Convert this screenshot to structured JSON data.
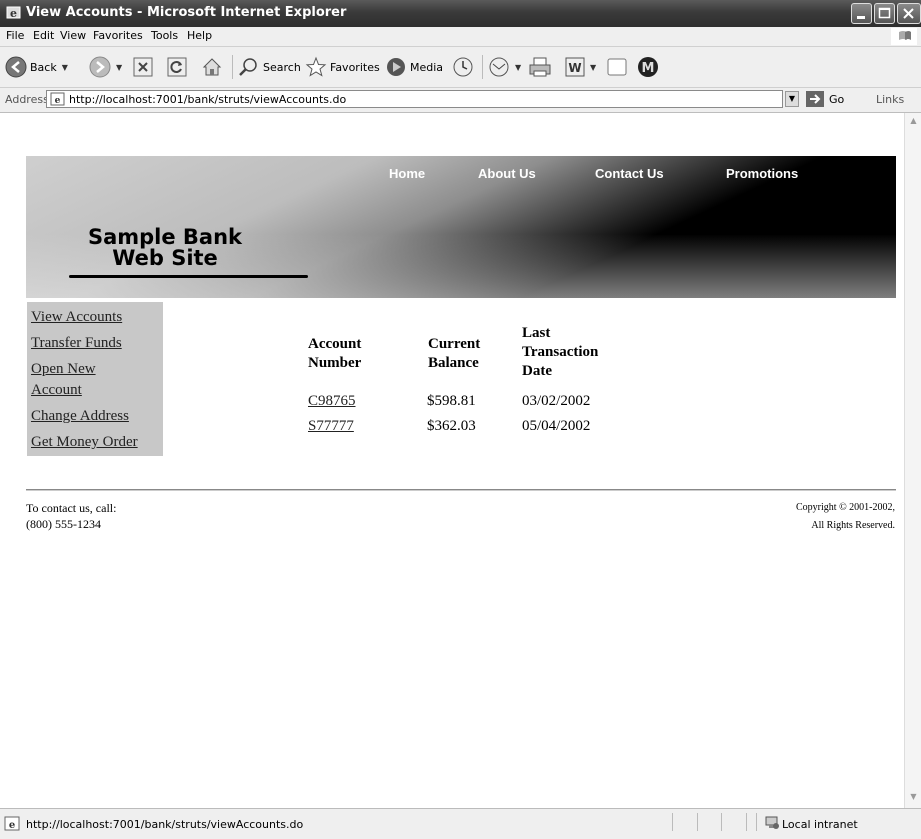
{
  "window": {
    "title": "View Accounts - Microsoft Internet Explorer"
  },
  "menu": [
    "File",
    "Edit",
    "View",
    "Favorites",
    "Tools",
    "Help"
  ],
  "toolbar": {
    "back_label": "Back",
    "search_label": "Search",
    "favorites_label": "Favorites",
    "media_label": "Media"
  },
  "address": {
    "label": "Address",
    "url": "http://localhost:7001/bank/struts/viewAccounts.do",
    "go_label": "Go",
    "links_label": "Links"
  },
  "site": {
    "nav": [
      "Home",
      "About Us",
      "Contact Us",
      "Promotions"
    ],
    "logo_line1": "Sample Bank",
    "logo_line2": "Web Site"
  },
  "sidebar": {
    "items": [
      "View Accounts",
      "Transfer Funds",
      "Open New",
      "Account",
      "Change Address",
      "Get Money Order"
    ]
  },
  "accounts": {
    "headers": {
      "number_l1": "Account",
      "number_l2": "Number",
      "balance_l1": "Current",
      "balance_l2": "Balance",
      "date_l1": "Last",
      "date_l2": "Transaction",
      "date_l3": "Date"
    },
    "rows": [
      {
        "number": "C98765",
        "balance": "$598.81",
        "date": "03/02/2002"
      },
      {
        "number": "S77777",
        "balance": "$362.03",
        "date": "05/04/2002"
      }
    ]
  },
  "footer": {
    "contact_line1": "To contact us, call:",
    "contact_line2": "(800) 555-1234",
    "copyright_line1": "Copyright © 2001-2002,",
    "copyright_line2": "All Rights Reserved."
  },
  "statusbar": {
    "text": "http://localhost:7001/bank/struts/viewAccounts.do",
    "zone": "Local intranet"
  }
}
